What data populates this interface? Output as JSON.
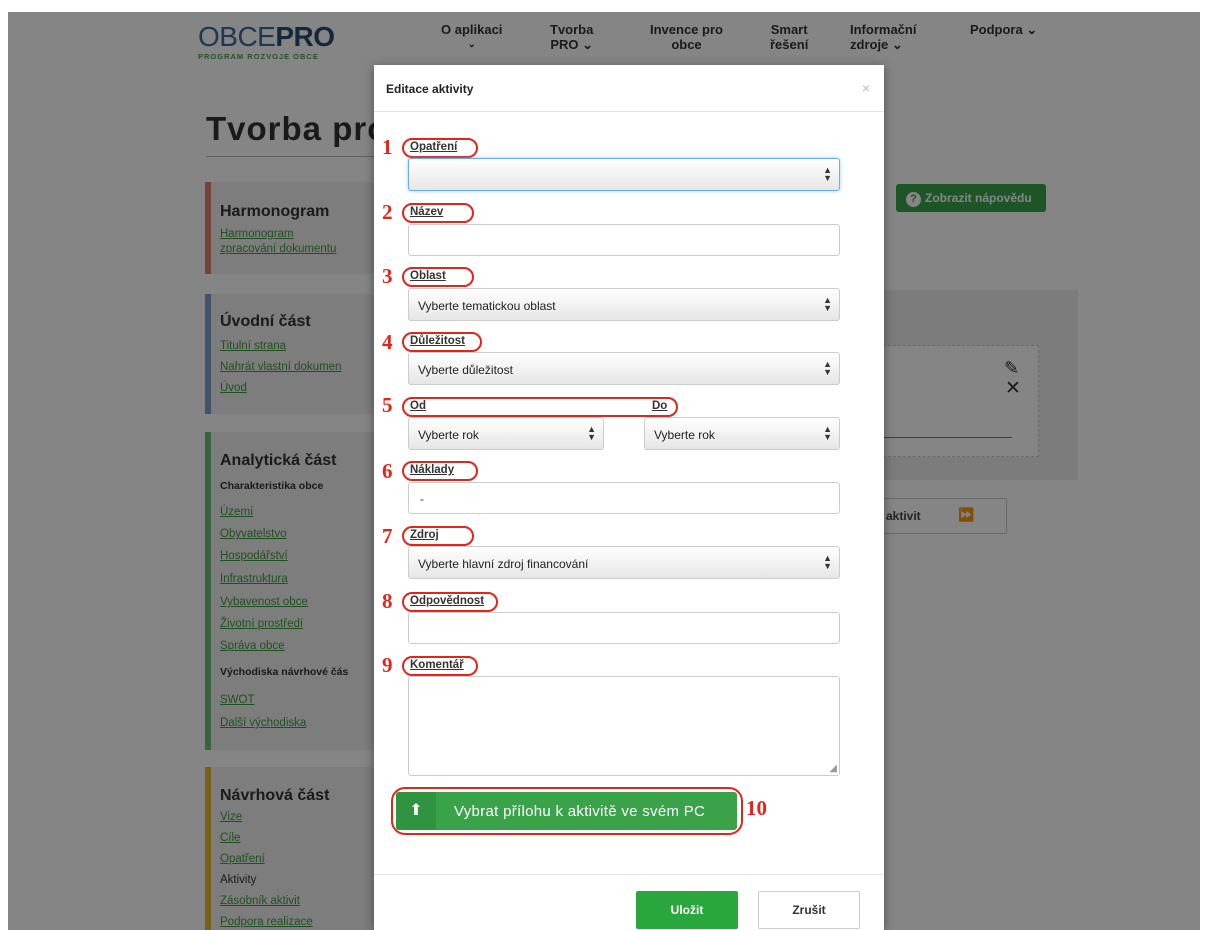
{
  "logo": {
    "thin": "OBCE",
    "bold": "PRO",
    "tagline": "PROGRAM ROZVOJE OBCE"
  },
  "nav": [
    {
      "label": "O aplikaci",
      "sub": "⌄"
    },
    {
      "label": "Tvorba",
      "sub": "PRO ⌄"
    },
    {
      "label": "Invence pro",
      "sub": "obce"
    },
    {
      "label": "Smart",
      "sub": "řešení"
    },
    {
      "label": "Informační",
      "sub": "zdroje ⌄"
    },
    {
      "label": "Podpora ⌄",
      "sub": ""
    }
  ],
  "page_title": "Tvorba pro",
  "help_button": "Zobrazit nápovědu",
  "sidebar": {
    "harmonogram": {
      "title": "Harmonogram",
      "links": [
        "Harmonogram",
        "zpracování dokumentu"
      ]
    },
    "uvodni": {
      "title": "Úvodní část",
      "links": [
        "Titulní strana",
        "Nahrát vlastní dokumen",
        "Úvod"
      ]
    },
    "analyticka": {
      "title": "Analytická část",
      "sub1": "Charakteristika obce",
      "links1": [
        "Území",
        "Obyvatelstvo",
        "Hospodářství",
        "Infrastruktura",
        "Vybavenost obce",
        "Životní prostředí",
        "Správa obce"
      ],
      "sub2": "Východiska návrhové čás",
      "links2": [
        "SWOT",
        "Další východiska"
      ]
    },
    "navrhova": {
      "title": "Návrhová část",
      "links": [
        "Vize",
        "Cíle",
        "Opatření"
      ],
      "current": "Aktivity",
      "links_after": [
        "Zásobník aktivit",
        "Podpora realizace"
      ]
    }
  },
  "right_panel": {
    "aktivit_label": "aktivit",
    "arrow": "⏩"
  },
  "modal": {
    "title": "Editace aktivity",
    "close": "×",
    "labels": {
      "opatreni": "Opatření",
      "nazev": "Název",
      "oblast": "Oblast",
      "dulezitost": "Důležitost",
      "od": "Od",
      "do": "Do",
      "naklady": "Náklady",
      "zdroj": "Zdroj",
      "odpovednost": "Odpovědnost",
      "komentar": "Komentář"
    },
    "values": {
      "opatreni": "",
      "nazev": "",
      "oblast": "Vyberte tematickou oblast",
      "dulezitost": "Vyberte důležitost",
      "od": "Vyberte rok",
      "do": "Vyberte rok",
      "naklady": "-",
      "zdroj": "Vyberte hlavní zdroj financování",
      "odpovednost": "",
      "komentar": ""
    },
    "numbers": [
      "1",
      "2",
      "3",
      "4",
      "5",
      "6",
      "7",
      "8",
      "9",
      "10"
    ],
    "upload_button": "Vybrat přílohu k aktivitě ve svém PC",
    "save_button": "Uložit",
    "cancel_button": "Zrušit"
  },
  "colors": {
    "accent_green": "#3aa34a",
    "annotation_red": "#e0251b",
    "overlay": "rgba(0,0,0,0.48)"
  }
}
